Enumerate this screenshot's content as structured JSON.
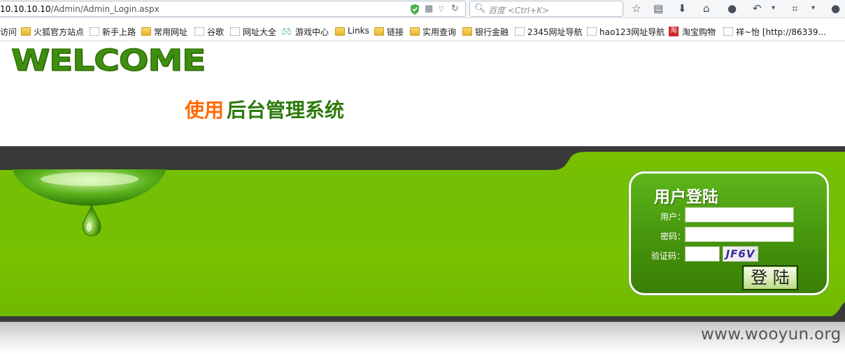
{
  "browser": {
    "url_host": "10.10.10.10",
    "url_path": "/Admin/Admin_Login.aspx",
    "search_placeholder": "百度 <Ctrl+K>"
  },
  "bookmarks": [
    {
      "label": "访问",
      "icon": "none"
    },
    {
      "label": "火狐官方站点",
      "icon": "folder"
    },
    {
      "label": "新手上路",
      "icon": "dashed"
    },
    {
      "label": "常用网址",
      "icon": "folder"
    },
    {
      "label": "谷歌",
      "icon": "dashed"
    },
    {
      "label": "网址大全",
      "icon": "dashed"
    },
    {
      "label": "游戏中心",
      "icon": "game"
    },
    {
      "label": "Links",
      "icon": "folder"
    },
    {
      "label": "链接",
      "icon": "folder"
    },
    {
      "label": "实用查询",
      "icon": "folder"
    },
    {
      "label": "银行金融",
      "icon": "folder"
    },
    {
      "label": "2345网址导航",
      "icon": "dashed"
    },
    {
      "label": "hao123网址导航",
      "icon": "dashed"
    },
    {
      "label": "淘宝购物",
      "icon": "taobao"
    },
    {
      "label": "祥~怡 [http://86339...",
      "icon": "dashed"
    }
  ],
  "header": {
    "welcome": "WELCOME",
    "use": "使用",
    "system": "后台管理系统"
  },
  "login": {
    "title": "用户登陆",
    "user_label": "用户：",
    "password_label": "密码：",
    "captcha_label": "验证码：",
    "captcha_code": "JF6V",
    "submit_label": "登 陆",
    "user_value": "",
    "password_value": "",
    "captcha_value": ""
  },
  "watermark": "www.wooyun.org",
  "colors": {
    "green": "#76c000",
    "dark_band": "#393939",
    "welcome": "#3f8f0f",
    "accent_orange": "#ff6a00"
  }
}
